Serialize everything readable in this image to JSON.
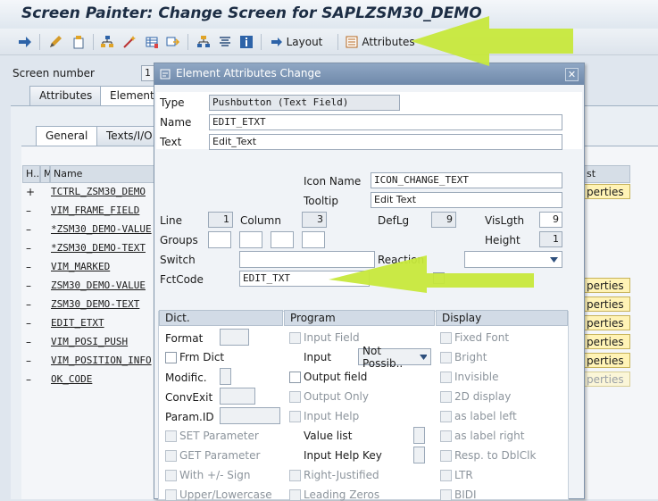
{
  "window_title": "Screen Painter: Change Screen for SAPLZSM30_DEMO",
  "toolbar": {
    "layout_label": "Layout",
    "attributes_label": "Attributes"
  },
  "background": {
    "screen_number_label": "Screen number",
    "screen_number_value": "1",
    "tabs": [
      "Attributes",
      "Element"
    ],
    "subtabs": [
      "General",
      "Texts/I/O"
    ],
    "grid_headers": [
      "H..",
      "M",
      "Name"
    ],
    "list_header_tail": "st",
    "rows": [
      {
        "h": "+",
        "name": "TCTRL_ZSM30_DEMO",
        "prop": "perties",
        "prop_disabled": false
      },
      {
        "h": "–",
        "name": "VIM_FRAME_FIELD",
        "prop": "",
        "prop_disabled": false
      },
      {
        "h": "–",
        "name": "*ZSM30_DEMO-VALUE",
        "prop": "",
        "prop_disabled": false
      },
      {
        "h": "–",
        "name": "*ZSM30_DEMO-TEXT",
        "prop": "",
        "prop_disabled": false
      },
      {
        "h": "–",
        "name": "VIM_MARKED",
        "prop": "",
        "prop_disabled": false
      },
      {
        "h": "–",
        "name": "ZSM30_DEMO-VALUE",
        "prop": "perties",
        "prop_disabled": false
      },
      {
        "h": "–",
        "name": "ZSM30_DEMO-TEXT",
        "prop": "perties",
        "prop_disabled": false
      },
      {
        "h": "–",
        "name": "EDIT_ETXT",
        "prop": "perties",
        "prop_disabled": false
      },
      {
        "h": "–",
        "name": "VIM_POSI_PUSH",
        "prop": "perties",
        "prop_disabled": false
      },
      {
        "h": "–",
        "name": "VIM_POSITION_INFO",
        "prop": "perties",
        "prop_disabled": false
      },
      {
        "h": "–",
        "name": "OK_CODE",
        "prop": "perties",
        "prop_disabled": true
      }
    ]
  },
  "dialog": {
    "title": "Element Attributes Change",
    "type_label": "Type",
    "type_value": "Pushbutton (Text Field)",
    "name_label": "Name",
    "name_value": "EDIT_ETXT",
    "text_label": "Text",
    "text_value": "Edit_Text",
    "icon_name_label": "Icon Name",
    "icon_name_value": "ICON_CHANGE_TEXT",
    "tooltip_label": "Tooltip",
    "tooltip_value": "Edit Text",
    "line_label": "Line",
    "line_value": "1",
    "column_label": "Column",
    "column_value": "3",
    "deflg_label": "DefLg",
    "deflg_value": "9",
    "vislgth_label": "VisLgth",
    "vislgth_value": "9",
    "groups_label": "Groups",
    "height_label": "Height",
    "height_value": "1",
    "switch_label": "Switch",
    "reaction_label": "Reaction",
    "fctcode_label": "FctCode",
    "fctcode_value": "EDIT_TXT",
    "dict": {
      "header": "Dict.",
      "format_label": "Format",
      "frm_dict_label": "Frm Dict",
      "modific_label": "Modific.",
      "convexit_label": "ConvExit",
      "paramid_label": "Param.ID",
      "set_param_label": "SET Parameter",
      "get_param_label": "GET Parameter",
      "with_sign_label": "With +/- Sign",
      "upper_lower_label": "Upper/Lowercase"
    },
    "program": {
      "header": "Program",
      "input_field_label": "Input Field",
      "input_label": "Input",
      "input_value": "Not Possib..",
      "output_field_label": "Output field",
      "output_only_label": "Output Only",
      "input_help_label": "Input Help",
      "value_list_label": "Value list",
      "input_help_key_label": "Input Help Key",
      "right_justified_label": "Right-Justified",
      "leading_zeros_label": "Leading Zeros"
    },
    "display": {
      "header": "Display",
      "fixed_font_label": "Fixed Font",
      "bright_label": "Bright",
      "invisible_label": "Invisible",
      "display_2d_label": "2D display",
      "label_left": "as label left",
      "label_right": "as label right",
      "resp_dblclk_label": "Resp. to DblClk",
      "ltr_label": "LTR",
      "bidi_label": "BIDI"
    }
  },
  "colors": {
    "highlight_arrow": "#c7e83b",
    "title_text": "#1c2d44",
    "dialog_title_bg": "#7f99b9"
  }
}
